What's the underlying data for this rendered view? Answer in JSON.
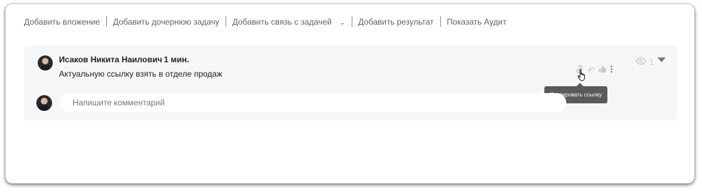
{
  "actions": {
    "add_attachment": "Добавить вложение",
    "add_subtask": "Добавить дочернюю задачу",
    "add_task_link": "Добавить связь с задачей",
    "add_result": "Добавить результат",
    "show_audit": "Показать Аудит"
  },
  "comment": {
    "author": "Исаков Никита Наилович",
    "time": "1 мин.",
    "text": "Актуальную ссылку взять в отделе продаж",
    "views": "1"
  },
  "tooltip": {
    "text": "Скопировать ссылку"
  },
  "reply": {
    "placeholder": "Напишите комментарий"
  },
  "icons": {
    "link": "link-icon",
    "reply": "reply-icon",
    "like": "thumbs-up-icon",
    "more": "more-vertical-icon",
    "views": "eye-icon",
    "cursor": "hand-cursor-icon"
  },
  "colors": {
    "background": "#f5f6f8",
    "tooltip_bg": "#5a5a5a",
    "muted_icon": "#c7c7c7"
  }
}
